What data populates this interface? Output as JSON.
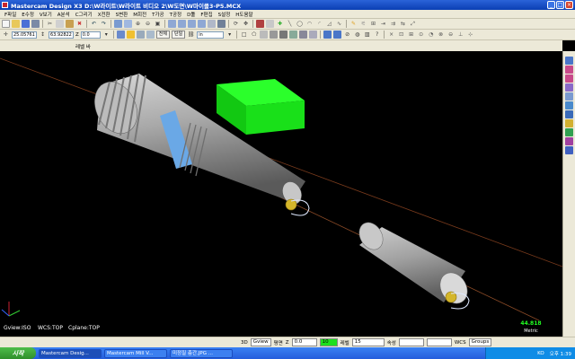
{
  "window": {
    "title": "Mastercam Design X3  D:\\W라이트\\W라이트 비디오 2\\W도면\\W마이클3-P5.MCX"
  },
  "menu": [
    "F파일",
    "E수정",
    "V보기",
    "A분석",
    "C그리기",
    "X전환",
    "S변환",
    "M회전",
    "T가공",
    "T공정",
    "D툴",
    "F편집",
    "S설정",
    "H도움말"
  ],
  "toolbar": {
    "coord_x": "25.05761",
    "coord_y": "63.92822",
    "z_label": "Z",
    "z_value": "0.0",
    "btn_all": "전체",
    "btn_single": "단일",
    "unit": "in"
  },
  "subheader": {
    "label": "레벨 바"
  },
  "viewport": {
    "gview": "Gview:ISO",
    "wcs": "WCS:TOP",
    "cplane": "Cplane:TOP",
    "scale_value": "44.818",
    "scale_unit": "Metric",
    "colors": {
      "background": "#000000",
      "box": "#1ee01e",
      "body": "#a9a9a9",
      "ring": "#6aa8e6",
      "axis": "#b85c2b"
    }
  },
  "status": {
    "mode3d": "3D",
    "gview": "Gview",
    "plane": "평면",
    "z": "Z",
    "z_value": "0.0",
    "level_color": "10",
    "level_label": "레벨",
    "level_value": "15",
    "attr": "속성",
    "wcs": "WCS",
    "groups": "Groups"
  },
  "taskbar": {
    "start": "시작",
    "tasks": [
      "Mastercam Desig...",
      "Mastercam Mill V...",
      "미정질 층간.JPG ..."
    ],
    "tray_lang": "KO",
    "clock": "오후 1:39"
  }
}
